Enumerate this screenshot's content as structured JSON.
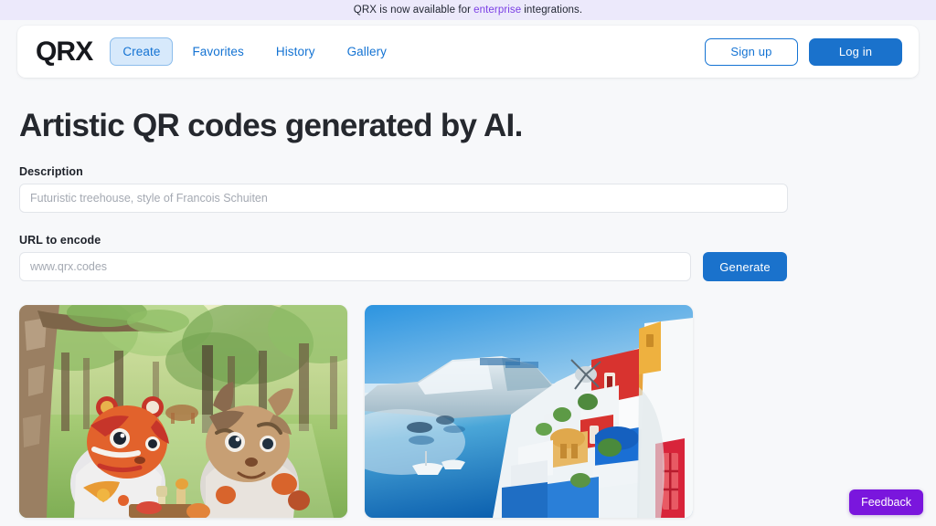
{
  "banner": {
    "text_before": "QRX is now available for",
    "link_label": "enterprise",
    "text_after": "integrations.",
    "link_color": "#7b3fe4",
    "background_color": "#ece9fb"
  },
  "nav": {
    "logo": "QRX",
    "links": [
      {
        "label": "Create",
        "active": true
      },
      {
        "label": "Favorites",
        "active": false
      },
      {
        "label": "History",
        "active": false
      },
      {
        "label": "Gallery",
        "active": false
      }
    ],
    "signup_label": "Sign up",
    "login_label": "Log in",
    "accent_color": "#1473d3",
    "active_pill_background": "#d7e9fb"
  },
  "main": {
    "headline": "Artistic QR codes generated by AI.",
    "description_label": "Description",
    "description_placeholder": "Futuristic treehouse, style of Francois Schuiten",
    "description_value": "",
    "url_label": "URL to encode",
    "url_placeholder": "www.qrx.codes",
    "url_value": "",
    "generate_label": "Generate"
  },
  "gallery": {
    "items": [
      {
        "alt": "Two stylized fox-like animal characters having a picnic in a sunlit green forest, artistic QR code art",
        "scene": "forest-picnic"
      },
      {
        "alt": "Santorini style Greek island cliffside village with white and red buildings over blue sea, artistic QR code art",
        "scene": "greek-island"
      }
    ]
  },
  "feedback": {
    "label": "Feedback",
    "color": "#7a16dd"
  }
}
